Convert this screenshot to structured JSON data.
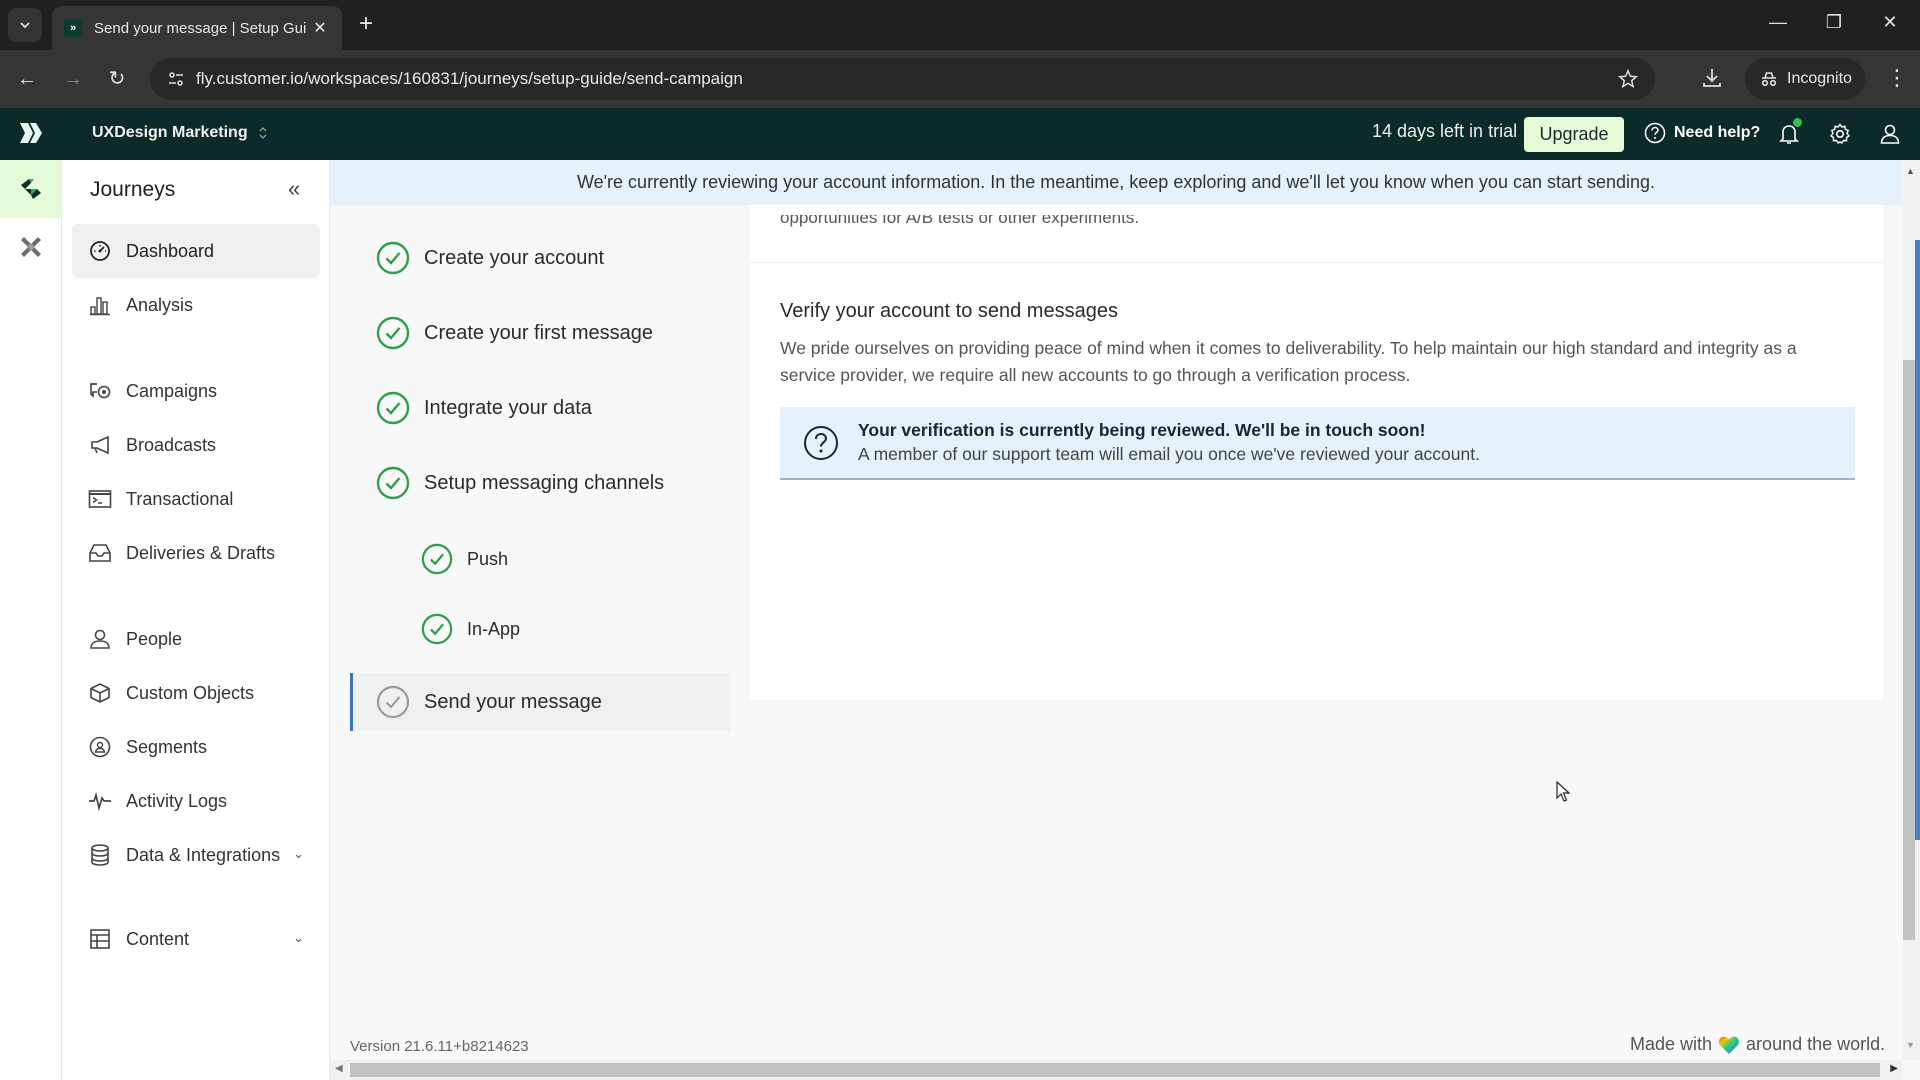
{
  "browser": {
    "tab_title": "Send your message | Setup Guide",
    "tab_title_display": "Send your message | Setup Gui",
    "url": "fly.customer.io/workspaces/160831/journeys/setup-guide/send-campaign",
    "incognito_label": "Incognito"
  },
  "header": {
    "workspace": "UXDesign Marketing",
    "trial_text": "14 days left in trial",
    "upgrade_label": "Upgrade",
    "help_label": "Need help?",
    "notification_dot_color": "#3dbb4a"
  },
  "sidebar": {
    "title": "Journeys",
    "items": [
      {
        "label": "Dashboard",
        "icon": "dashboard-icon",
        "active": true
      },
      {
        "label": "Analysis",
        "icon": "bar-chart-icon"
      },
      {
        "label": "Campaigns",
        "icon": "campaigns-icon"
      },
      {
        "label": "Broadcasts",
        "icon": "megaphone-icon"
      },
      {
        "label": "Transactional",
        "icon": "terminal-icon"
      },
      {
        "label": "Deliveries & Drafts",
        "icon": "inbox-icon"
      },
      {
        "label": "People",
        "icon": "person-icon"
      },
      {
        "label": "Custom Objects",
        "icon": "cube-icon"
      },
      {
        "label": "Segments",
        "icon": "segments-icon"
      },
      {
        "label": "Activity Logs",
        "icon": "pulse-icon"
      },
      {
        "label": "Data & Integrations",
        "icon": "database-icon",
        "expandable": true
      },
      {
        "label": "Content",
        "icon": "layout-icon",
        "expandable": true
      }
    ]
  },
  "banner": {
    "text": "We're currently reviewing your account information. In the meantime, keep exploring and we'll let you know when you can start sending."
  },
  "steps": [
    {
      "label": "Create your account",
      "status": "complete"
    },
    {
      "label": "Create your first message",
      "status": "complete"
    },
    {
      "label": "Integrate your data",
      "status": "complete"
    },
    {
      "label": "Setup messaging channels",
      "status": "complete"
    },
    {
      "label": "Push",
      "status": "complete",
      "sub": true
    },
    {
      "label": "In-App",
      "status": "complete",
      "sub": true
    },
    {
      "label": "Send your message",
      "status": "current"
    }
  ],
  "content": {
    "previous_text": "opportunities for A/B tests or other experiments.",
    "heading": "Verify your account to send messages",
    "description": "We pride ourselves on providing peace of mind when it comes to deliverability. To help maintain our high standard and integrity as a service provider, we require all new accounts to go through a verification process.",
    "notice_title": "Your verification is currently being reviewed. We'll be in touch soon!",
    "notice_body": "A member of our support team will email you once we've reviewed your account."
  },
  "footer": {
    "version": "Version 21.6.11+b8214623",
    "made_with_before": "Made with",
    "made_with_after": "around the world."
  },
  "colors": {
    "header_bg": "#0c2a27",
    "accent_green": "#2e9e4f",
    "upgrade_bg": "#e6fbd8",
    "current_step_border": "#3b72c2",
    "banner_bg": "#e5f1fb"
  }
}
